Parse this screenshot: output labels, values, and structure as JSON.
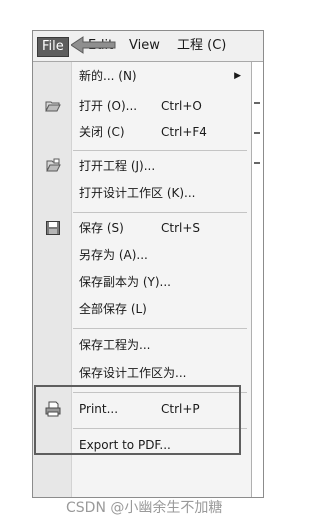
{
  "menubar": {
    "file": "File",
    "edit": "Edit",
    "view": "View",
    "project": "工程 (C)"
  },
  "menu": {
    "new": {
      "label": "新的... (N)"
    },
    "open": {
      "label": "打开 (O)...",
      "shortcut": "Ctrl+O"
    },
    "close": {
      "label": "关闭 (C)",
      "shortcut": "Ctrl+F4"
    },
    "open_project": {
      "label": "打开工程 (J)..."
    },
    "open_workspace": {
      "label": "打开设计工作区 (K)..."
    },
    "save": {
      "label": "保存 (S)",
      "shortcut": "Ctrl+S"
    },
    "save_as": {
      "label": "另存为 (A)..."
    },
    "save_copy_as": {
      "label": "保存副本为 (Y)..."
    },
    "save_all": {
      "label": "全部保存 (L)"
    },
    "save_project_as": {
      "label": "保存工程为..."
    },
    "save_workspace_as": {
      "label": "保存设计工作区为..."
    },
    "print": {
      "label": "Print...",
      "shortcut": "Ctrl+P"
    },
    "export_pdf": {
      "label": "Export to PDF..."
    }
  },
  "icons": {
    "open": "folder-open-icon",
    "open_project": "project-open-icon",
    "save": "floppy-disk-icon",
    "print": "printer-icon",
    "submenu": "submenu-arrow-icon"
  },
  "watermark": "CSDN @小幽余生不加糖"
}
